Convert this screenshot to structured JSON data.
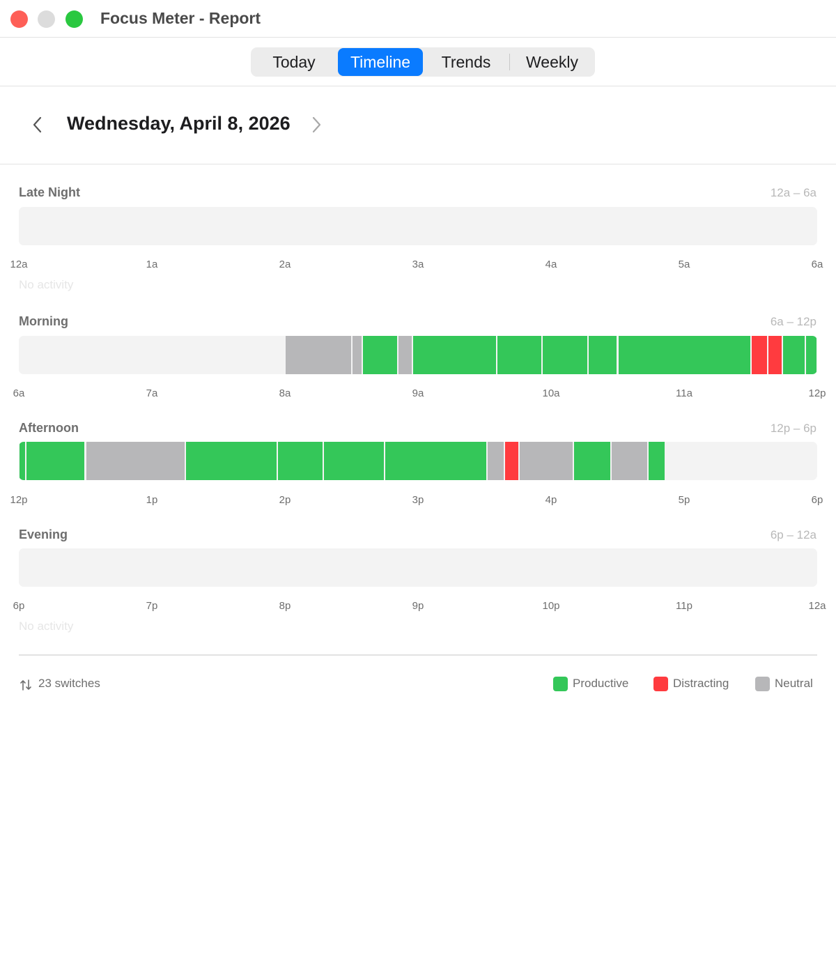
{
  "window": {
    "title": "Focus Meter - Report"
  },
  "tabs": [
    {
      "label": "Today",
      "active": false
    },
    {
      "label": "Timeline",
      "active": true
    },
    {
      "label": "Trends",
      "active": false
    },
    {
      "label": "Weekly",
      "active": false
    }
  ],
  "date_nav": {
    "date": "Wednesday, April 8, 2026",
    "prev_icon": "chevron-left-icon",
    "next_icon": "chevron-right-icon"
  },
  "colors": {
    "productive": "#34c759",
    "distracting": "#ff3b3f",
    "neutral": "#b7b7b9",
    "empty": "#f3f3f3",
    "accent": "#0a7bff"
  },
  "sections": [
    {
      "title": "Late Night",
      "range": "12a – 6a",
      "ticks": [
        "12a",
        "1a",
        "2a",
        "3a",
        "4a",
        "5a",
        "6a"
      ],
      "blocks": [],
      "empty_text": "No activity"
    },
    {
      "title": "Morning",
      "range": "6a – 12p",
      "ticks": [
        "6a",
        "7a",
        "8a",
        "9a",
        "10a",
        "11a",
        "12p"
      ],
      "blocks": [
        {
          "category": "neutral",
          "start": 2.0,
          "end": 2.5
        },
        {
          "category": "neutral",
          "start": 2.5,
          "end": 2.58
        },
        {
          "category": "productive",
          "start": 2.58,
          "end": 2.85
        },
        {
          "category": "neutral",
          "start": 2.85,
          "end": 2.96
        },
        {
          "category": "productive",
          "start": 2.96,
          "end": 3.59
        },
        {
          "category": "productive",
          "start": 3.59,
          "end": 3.93
        },
        {
          "category": "productive",
          "start": 3.93,
          "end": 4.28
        },
        {
          "category": "productive",
          "start": 4.28,
          "end": 4.5
        },
        {
          "category": "productive",
          "start": 4.5,
          "end": 5.5
        },
        {
          "category": "distracting",
          "start": 5.5,
          "end": 5.63
        },
        {
          "category": "distracting",
          "start": 5.63,
          "end": 5.74
        },
        {
          "category": "productive",
          "start": 5.74,
          "end": 5.91
        },
        {
          "category": "productive",
          "start": 5.91,
          "end": 6.0
        }
      ],
      "empty_text": ""
    },
    {
      "title": "Afternoon",
      "range": "12p – 6p",
      "ticks": [
        "12p",
        "1p",
        "2p",
        "3p",
        "4p",
        "5p",
        "6p"
      ],
      "blocks": [
        {
          "category": "productive",
          "start": 0.0,
          "end": 0.05
        },
        {
          "category": "productive",
          "start": 0.05,
          "end": 0.5
        },
        {
          "category": "neutral",
          "start": 0.5,
          "end": 1.25
        },
        {
          "category": "productive",
          "start": 1.25,
          "end": 1.94
        },
        {
          "category": "productive",
          "start": 1.94,
          "end": 2.29
        },
        {
          "category": "productive",
          "start": 2.29,
          "end": 2.75
        },
        {
          "category": "productive",
          "start": 2.75,
          "end": 3.52
        },
        {
          "category": "neutral",
          "start": 3.52,
          "end": 3.65
        },
        {
          "category": "distracting",
          "start": 3.65,
          "end": 3.76
        },
        {
          "category": "neutral",
          "start": 3.76,
          "end": 4.17
        },
        {
          "category": "productive",
          "start": 4.17,
          "end": 4.45
        },
        {
          "category": "neutral",
          "start": 4.45,
          "end": 4.73
        },
        {
          "category": "productive",
          "start": 4.73,
          "end": 4.86
        }
      ],
      "empty_text": ""
    },
    {
      "title": "Evening",
      "range": "6p – 12a",
      "ticks": [
        "6p",
        "7p",
        "8p",
        "9p",
        "10p",
        "11p",
        "12a"
      ],
      "blocks": [],
      "empty_text": "No activity"
    }
  ],
  "footer": {
    "switches_icon": "switch-arrows-icon",
    "switches_text": "23 switches",
    "legend": [
      {
        "label": "Productive",
        "category": "productive"
      },
      {
        "label": "Distracting",
        "category": "distracting"
      },
      {
        "label": "Neutral",
        "category": "neutral"
      }
    ]
  }
}
